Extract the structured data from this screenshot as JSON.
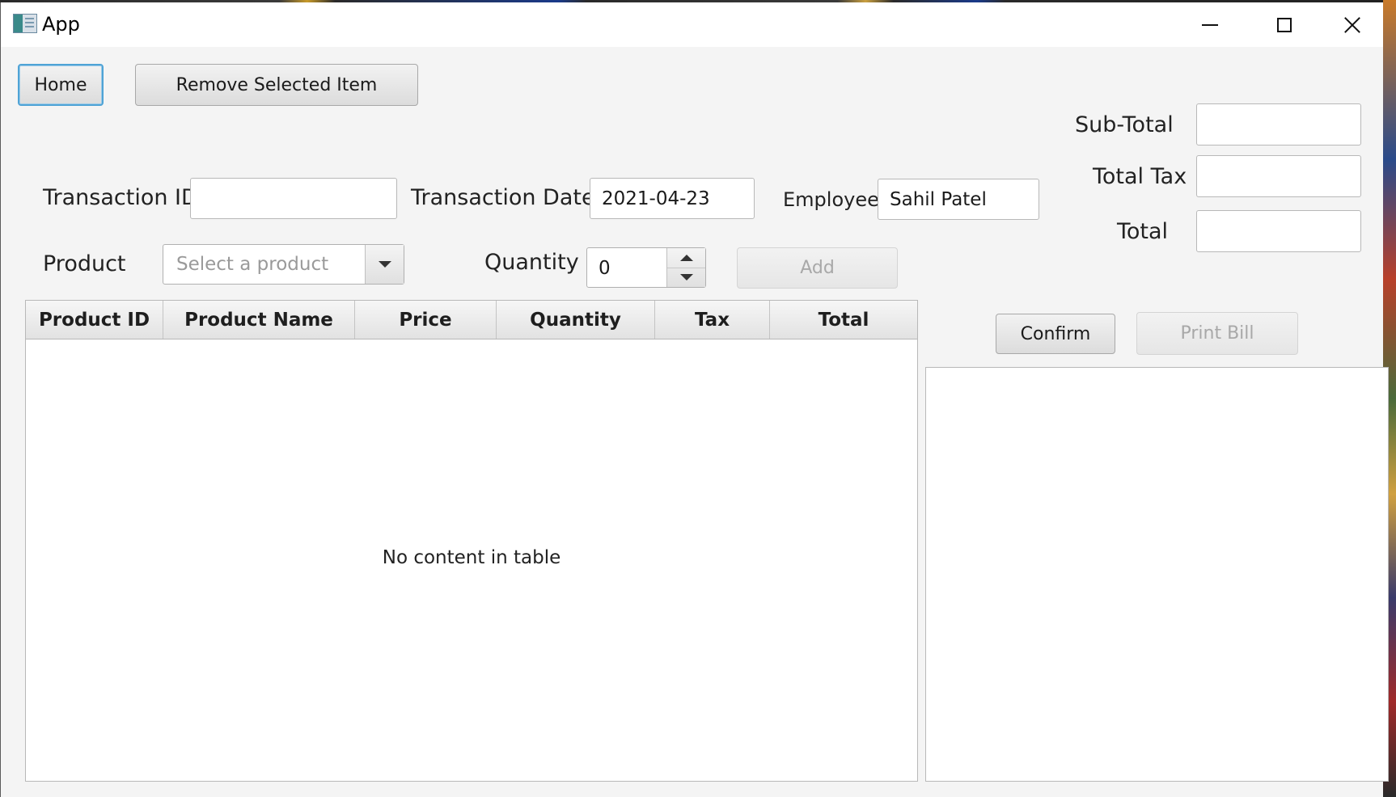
{
  "window": {
    "title": "App",
    "app_icon": "app-window-icon",
    "controls": [
      "minimize-icon",
      "maximize-icon",
      "close-icon"
    ]
  },
  "toolbar": {
    "home_label": "Home",
    "remove_label": "Remove Selected Item"
  },
  "form": {
    "transaction_id_label": "Transaction ID",
    "transaction_id_value": "",
    "transaction_date_label": "Transaction Date",
    "transaction_date_value": "2021-04-23",
    "employee_label": "Employee",
    "employee_value": "Sahil Patel",
    "product_label": "Product",
    "product_placeholder": "Select a product",
    "quantity_label": "Quantity",
    "quantity_value": "0",
    "add_label": "Add"
  },
  "totals": {
    "subtotal_label": "Sub-Total",
    "subtotal_value": "",
    "total_tax_label": "Total Tax",
    "total_tax_value": "",
    "total_label": "Total",
    "total_value": ""
  },
  "actions": {
    "confirm_label": "Confirm",
    "print_label": "Print Bill"
  },
  "table": {
    "columns": [
      "Product ID",
      "Product Name",
      "Price",
      "Quantity",
      "Tax",
      "Total"
    ],
    "rows": [],
    "empty_message": "No content in table"
  },
  "bill_preview": ""
}
